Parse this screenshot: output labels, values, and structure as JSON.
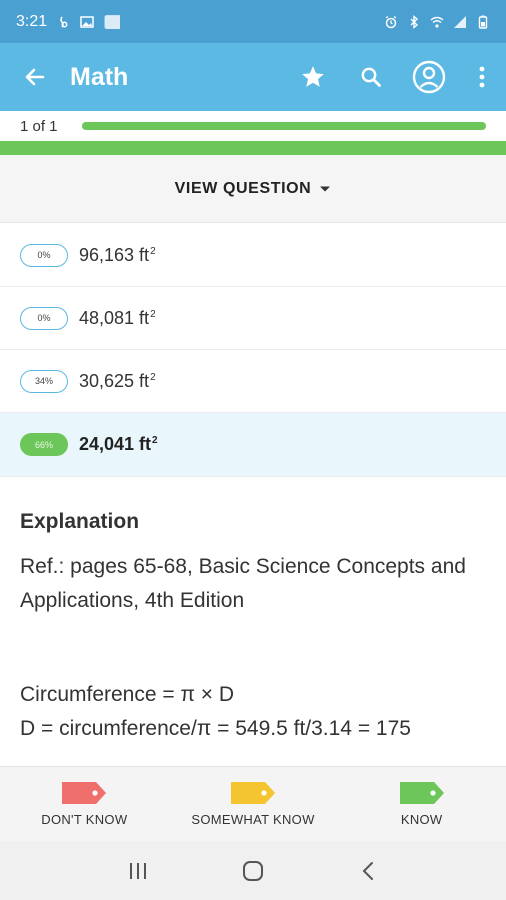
{
  "status_bar": {
    "time": "3:21",
    "left_icons": [
      "notification-icon",
      "image-icon",
      "app-icon"
    ],
    "right_icons": [
      "alarm-icon",
      "bluetooth-icon",
      "wifi-icon",
      "signal-icon",
      "battery-icon"
    ]
  },
  "app_bar": {
    "title": "Math",
    "icons": [
      "back-arrow-icon",
      "star-icon",
      "search-icon",
      "account-icon",
      "more-vert-icon"
    ],
    "color": "#5cb9e3"
  },
  "progress": {
    "label": "1 of 1",
    "fraction": 1.0,
    "color": "#6dc65a"
  },
  "view_question": {
    "label": "VIEW QUESTION"
  },
  "answers": [
    {
      "percent": "0%",
      "value": "96,163 ft",
      "unit_sup": "2",
      "correct": false
    },
    {
      "percent": "0%",
      "value": "48,081 ft",
      "unit_sup": "2",
      "correct": false
    },
    {
      "percent": "34%",
      "value": "30,625 ft",
      "unit_sup": "2",
      "correct": false
    },
    {
      "percent": "66%",
      "value": "24,041 ft",
      "unit_sup": "2",
      "correct": true
    }
  ],
  "explanation": {
    "heading": "Explanation",
    "ref": "Ref.: pages 65-68, Basic Science Concepts and Applications, 4th Edition",
    "formula_line1": "Circumference = π × D",
    "formula_line2": "D = circumference/π = 549.5 ft/3.14 = 175"
  },
  "knowledge_buttons": [
    {
      "label": "DON'T KNOW",
      "color": "#ef6f6c"
    },
    {
      "label": "SOMEWHAT KNOW",
      "color": "#f4c52e"
    },
    {
      "label": "KNOW",
      "color": "#6dc65a"
    }
  ],
  "nav_bar": {
    "icons": [
      "recents-icon",
      "home-icon",
      "back-icon"
    ]
  }
}
